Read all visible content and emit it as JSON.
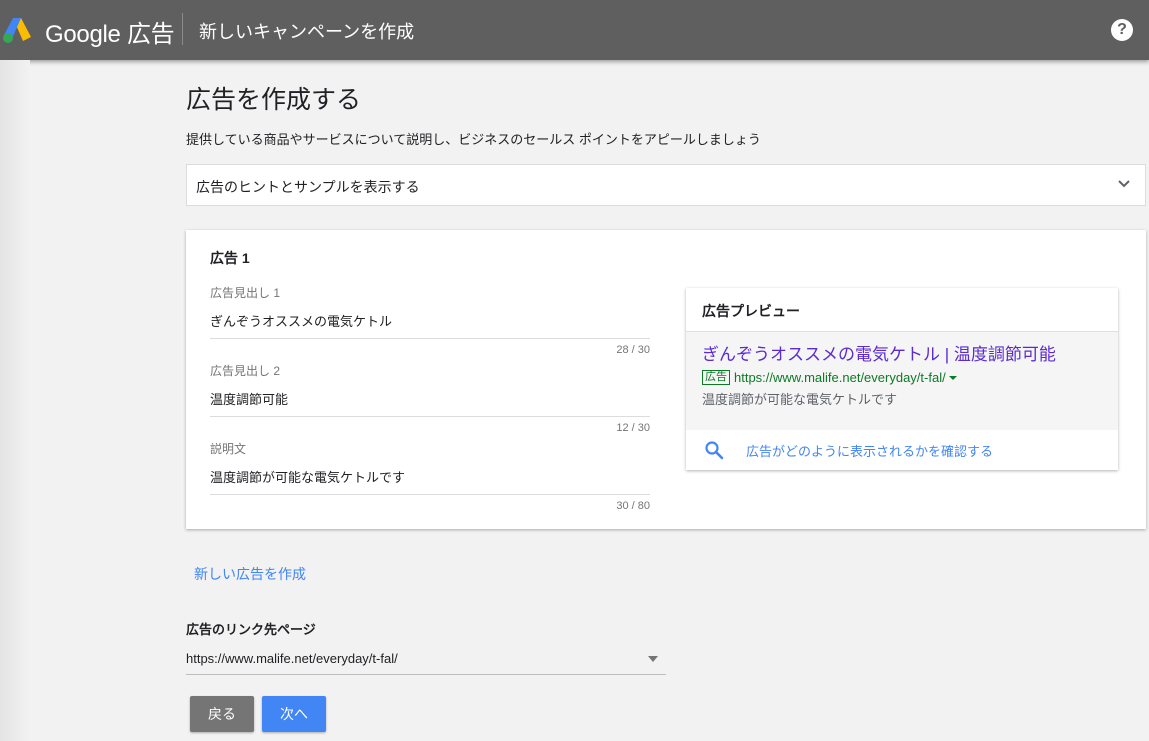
{
  "header": {
    "brand": "Google 広告",
    "title": "新しいキャンペーンを作成",
    "help_icon_glyph": "?",
    "logo_icon": "google-ads-logo",
    "help_icon": "help-icon"
  },
  "page": {
    "title": "広告を作成する",
    "subtitle": "提供している商品やサービスについて説明し、ビジネスのセールス ポイントをアピールしましょう",
    "hints_label": "広告のヒントとサンプルを表示する"
  },
  "ad": {
    "title": "広告 1",
    "fields": [
      {
        "label": "広告見出し 1",
        "value": "ぎんぞうオススメの電気ケトル",
        "count": "28 / 30"
      },
      {
        "label": "広告見出し 2",
        "value": "温度調節可能",
        "count": "12 / 30"
      },
      {
        "label": "説明文",
        "value": "温度調節が可能な電気ケトルです",
        "count": "30 / 80"
      }
    ]
  },
  "preview": {
    "header": "広告プレビュー",
    "headline": "ぎんぞうオススメの電気ケトル | 温度調節可能",
    "badge": "広告",
    "url": "https://www.malife.net/everyday/t-fal/",
    "description": "温度調節が可能な電気ケトルです",
    "footer_link": "広告がどのように表示されるかを確認する"
  },
  "new_ad_link": "新しい広告を作成",
  "landing": {
    "label": "広告のリンク先ページ",
    "value": "https://www.malife.net/everyday/t-fal/"
  },
  "buttons": {
    "back": "戻る",
    "next": "次へ"
  },
  "colors": {
    "header_bg": "#5f5f5f",
    "link_blue": "#4285f4",
    "headline_purple": "#5a2bd3",
    "url_green": "#0d7a25",
    "back_button": "#757575"
  }
}
